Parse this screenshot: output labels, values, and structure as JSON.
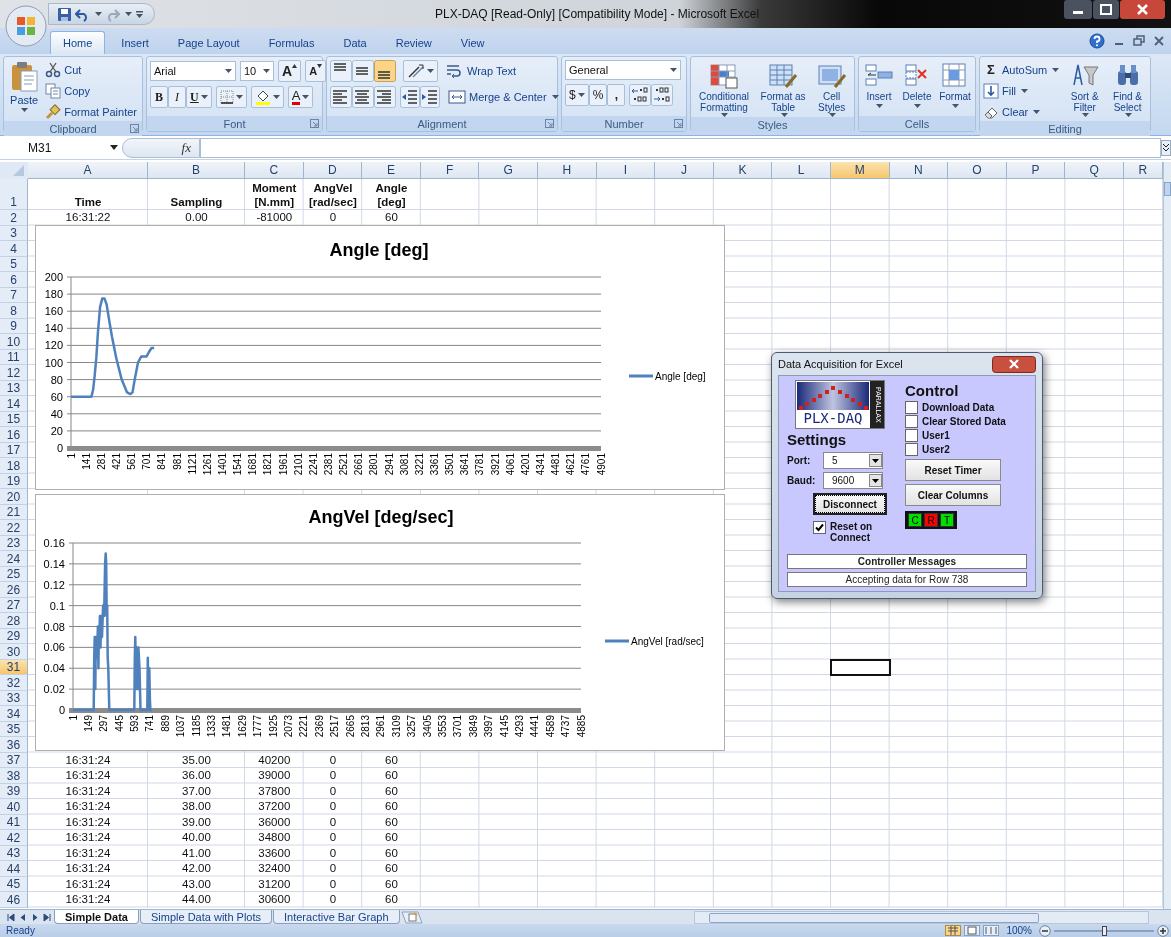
{
  "title_bar": {
    "title": "PLX-DAQ  [Read-Only]  [Compatibility Mode] - Microsoft Excel"
  },
  "ribbon_tabs": [
    {
      "label": "Home",
      "selected": true
    },
    {
      "label": "Insert",
      "selected": false
    },
    {
      "label": "Page Layout",
      "selected": false
    },
    {
      "label": "Formulas",
      "selected": false
    },
    {
      "label": "Data",
      "selected": false
    },
    {
      "label": "Review",
      "selected": false
    },
    {
      "label": "View",
      "selected": false
    }
  ],
  "ribbon": {
    "clipboard": {
      "label": "Clipboard",
      "paste": "Paste",
      "cut": "Cut",
      "copy": "Copy",
      "format_painter": "Format Painter"
    },
    "font": {
      "label": "Font",
      "font_name": "Arial",
      "font_size": "10",
      "grow": "A",
      "shrink": "A",
      "styles": [
        {
          "label": "B",
          "kind": "bold"
        },
        {
          "label": "I",
          "kind": "italic"
        },
        {
          "label": "U",
          "kind": "underline"
        }
      ],
      "font_color": "A"
    },
    "alignment": {
      "label": "Alignment",
      "vertical": [
        {
          "kind": "top",
          "selected": false
        },
        {
          "kind": "middle",
          "selected": false
        },
        {
          "kind": "bottom",
          "selected": true
        }
      ],
      "horizontal": [
        {
          "kind": "left",
          "selected": false
        },
        {
          "kind": "center",
          "selected": false
        },
        {
          "kind": "right",
          "selected": false
        }
      ],
      "wrap_text": "Wrap Text",
      "merge_center": "Merge & Center"
    },
    "number": {
      "label": "Number",
      "format": "General",
      "currency": "$",
      "percent": "%",
      "comma": ","
    },
    "styles": {
      "label": "Styles",
      "buttons": [
        {
          "label": "Conditional Formatting",
          "kind": "conditional"
        },
        {
          "label": "Format as Table",
          "kind": "table"
        },
        {
          "label": "Cell Styles",
          "kind": "cell_styles"
        }
      ]
    },
    "cells": {
      "label": "Cells",
      "buttons": [
        {
          "label": "Insert",
          "kind": "insert"
        },
        {
          "label": "Delete",
          "kind": "delete"
        },
        {
          "label": "Format",
          "kind": "format"
        }
      ]
    },
    "editing": {
      "label": "Editing",
      "autosum_symbol": "Σ",
      "autosum": "AutoSum",
      "fill": "Fill",
      "clear": "Clear",
      "sort_filter": "Sort & Filter",
      "find_select": "Find & Select"
    }
  },
  "formula_bar": {
    "name_box": "M31",
    "fx": "fx"
  },
  "sheet": {
    "columns": [
      {
        "label": "A",
        "selected": false
      },
      {
        "label": "B",
        "selected": false
      },
      {
        "label": "C",
        "selected": false
      },
      {
        "label": "D",
        "selected": false
      },
      {
        "label": "E",
        "selected": false
      },
      {
        "label": "F",
        "selected": false
      },
      {
        "label": "G",
        "selected": false
      },
      {
        "label": "H",
        "selected": false
      },
      {
        "label": "I",
        "selected": false
      },
      {
        "label": "J",
        "selected": false
      },
      {
        "label": "K",
        "selected": false
      },
      {
        "label": "L",
        "selected": false
      },
      {
        "label": "M",
        "selected": true
      },
      {
        "label": "N",
        "selected": false
      },
      {
        "label": "O",
        "selected": false
      },
      {
        "label": "P",
        "selected": false
      },
      {
        "label": "Q",
        "selected": false
      },
      {
        "label": "R",
        "selected": false
      }
    ],
    "rows": [
      {
        "number": "1",
        "selected": false,
        "kind": "header",
        "cells": [
          "Time",
          "Sampling",
          "Moment [N.mm]",
          "AngVel [rad/sec]",
          "Angle [deg]"
        ]
      },
      {
        "number": "2",
        "selected": false,
        "kind": "data",
        "cells": [
          "16:31:22",
          "0.00",
          "-81000",
          "0",
          "60"
        ]
      },
      {
        "number": "3",
        "selected": false,
        "kind": "data"
      },
      {
        "number": "4",
        "selected": false,
        "kind": "data"
      },
      {
        "number": "5",
        "selected": false,
        "kind": "data"
      },
      {
        "number": "6",
        "selected": false,
        "kind": "data"
      },
      {
        "number": "7",
        "selected": false,
        "kind": "data"
      },
      {
        "number": "8",
        "selected": false,
        "kind": "data"
      },
      {
        "number": "9",
        "selected": false,
        "kind": "data"
      },
      {
        "number": "10",
        "selected": false,
        "kind": "data"
      },
      {
        "number": "11",
        "selected": false,
        "kind": "data"
      },
      {
        "number": "12",
        "selected": false,
        "kind": "data"
      },
      {
        "number": "13",
        "selected": false,
        "kind": "data"
      },
      {
        "number": "14",
        "selected": false,
        "kind": "data"
      },
      {
        "number": "15",
        "selected": false,
        "kind": "data"
      },
      {
        "number": "16",
        "selected": false,
        "kind": "data"
      },
      {
        "number": "17",
        "selected": false,
        "kind": "data"
      },
      {
        "number": "18",
        "selected": false,
        "kind": "data"
      },
      {
        "number": "19",
        "selected": false,
        "kind": "data"
      },
      {
        "number": "20",
        "selected": false,
        "kind": "data"
      },
      {
        "number": "21",
        "selected": false,
        "kind": "data"
      },
      {
        "number": "22",
        "selected": false,
        "kind": "data"
      },
      {
        "number": "23",
        "selected": false,
        "kind": "data"
      },
      {
        "number": "24",
        "selected": false,
        "kind": "data"
      },
      {
        "number": "25",
        "selected": false,
        "kind": "data"
      },
      {
        "number": "26",
        "selected": false,
        "kind": "data"
      },
      {
        "number": "27",
        "selected": false,
        "kind": "data"
      },
      {
        "number": "28",
        "selected": false,
        "kind": "data"
      },
      {
        "number": "29",
        "selected": false,
        "kind": "data"
      },
      {
        "number": "30",
        "selected": false,
        "kind": "data"
      },
      {
        "number": "31",
        "selected": true,
        "kind": "data"
      },
      {
        "number": "32",
        "selected": false,
        "kind": "data"
      },
      {
        "number": "33",
        "selected": false,
        "kind": "data"
      },
      {
        "number": "34",
        "selected": false,
        "kind": "data"
      },
      {
        "number": "35",
        "selected": false,
        "kind": "data"
      },
      {
        "number": "36",
        "selected": false,
        "kind": "data"
      },
      {
        "number": "37",
        "selected": false,
        "kind": "data",
        "cells": [
          "16:31:24",
          "35.00",
          "40200",
          "0",
          "60"
        ]
      },
      {
        "number": "38",
        "selected": false,
        "kind": "data",
        "cells": [
          "16:31:24",
          "36.00",
          "39000",
          "0",
          "60"
        ]
      },
      {
        "number": "39",
        "selected": false,
        "kind": "data",
        "cells": [
          "16:31:24",
          "37.00",
          "37800",
          "0",
          "60"
        ]
      },
      {
        "number": "40",
        "selected": false,
        "kind": "data",
        "cells": [
          "16:31:24",
          "38.00",
          "37200",
          "0",
          "60"
        ]
      },
      {
        "number": "41",
        "selected": false,
        "kind": "data",
        "cells": [
          "16:31:24",
          "39.00",
          "36000",
          "0",
          "60"
        ]
      },
      {
        "number": "42",
        "selected": false,
        "kind": "data",
        "cells": [
          "16:31:24",
          "40.00",
          "34800",
          "0",
          "60"
        ]
      },
      {
        "number": "43",
        "selected": false,
        "kind": "data",
        "cells": [
          "16:31:24",
          "41.00",
          "33600",
          "0",
          "60"
        ]
      },
      {
        "number": "44",
        "selected": false,
        "kind": "data",
        "cells": [
          "16:31:24",
          "42.00",
          "32400",
          "0",
          "60"
        ]
      },
      {
        "number": "45",
        "selected": false,
        "kind": "data",
        "cells": [
          "16:31:24",
          "43.00",
          "31200",
          "0",
          "60"
        ]
      },
      {
        "number": "46",
        "selected": false,
        "kind": "data",
        "cells": [
          "16:31:24",
          "44.00",
          "30600",
          "0",
          "60"
        ]
      }
    ],
    "charts": [
      {
        "chart_data": {
          "type": "line",
          "title": "Angle [deg]",
          "x": [
            1,
            190,
            205,
            220,
            235,
            250,
            270,
            290,
            310,
            330,
            360,
            380,
            420,
            470,
            520,
            550,
            570,
            590,
            620,
            650,
            670,
            700,
            720,
            745,
            770
          ],
          "series": [
            {
              "name": "Angle [deg]",
              "color": "#4f81bd",
              "values": [
                60,
                60,
                68,
                85,
                105,
                135,
                165,
                175,
                175,
                168,
                145,
                130,
                105,
                80,
                65,
                63,
                65,
                80,
                100,
                107,
                107,
                107,
                112,
                117,
                117
              ]
            }
          ],
          "xlim": [
            1,
            4901
          ],
          "ylim": [
            0,
            200
          ],
          "grid": true,
          "yticks": [
            0,
            20,
            40,
            60,
            80,
            100,
            120,
            140,
            160,
            180,
            200
          ],
          "xticks": [
            1,
            141,
            281,
            421,
            561,
            701,
            841,
            981,
            1121,
            1261,
            1401,
            1541,
            1681,
            1821,
            1961,
            2101,
            2241,
            2381,
            2521,
            2661,
            2801,
            2941,
            3081,
            3221,
            3361,
            3501,
            3641,
            3781,
            3921,
            4061,
            4201,
            4341,
            4481,
            4621,
            4761,
            4901
          ]
        }
      },
      {
        "chart_data": {
          "type": "line",
          "title": "AngVel [deg/sec]",
          "x": [
            1,
            200,
            205,
            210,
            215,
            220,
            225,
            230,
            235,
            240,
            245,
            250,
            255,
            260,
            265,
            270,
            280,
            290,
            300,
            310,
            315,
            320,
            325,
            330,
            335,
            340,
            345,
            350,
            360,
            590,
            595,
            600,
            605,
            610,
            615,
            620,
            625,
            630,
            640,
            650,
            660,
            665,
            680,
            715,
            720,
            725,
            730,
            735,
            740,
            745,
            760
          ],
          "series": [
            {
              "name": "AngVel [rad/sec]",
              "color": "#4f81bd",
              "values": [
                0,
                0,
                0.05,
                0.07,
                0.02,
                0.07,
                0.05,
                0.07,
                0.06,
                0.08,
                0.04,
                0.08,
                0.07,
                0.09,
                0.06,
                0.09,
                0.07,
                0.1,
                0.09,
                0.14,
                0.15,
                0.14,
                0.09,
                0.1,
                0.05,
                0.04,
                0.02,
                0,
                0,
                0,
                0.05,
                0.07,
                0.04,
                0.02,
                0.06,
                0.05,
                0.02,
                0.06,
                0.04,
                0,
                0,
                0,
                0,
                0,
                0.05,
                0.02,
                0,
                0.04,
                0.01,
                0,
                0
              ]
            }
          ],
          "xlim": [
            1,
            4885
          ],
          "ylim": [
            0,
            0.16
          ],
          "grid": true,
          "yticks": [
            0,
            0.02,
            0.04,
            0.06,
            0.08,
            0.1,
            0.12,
            0.14,
            0.16
          ],
          "xticks": [
            1,
            149,
            297,
            445,
            593,
            741,
            889,
            1037,
            1185,
            1333,
            1481,
            1629,
            1777,
            1925,
            2073,
            2221,
            2369,
            2517,
            2665,
            2813,
            2961,
            3109,
            3257,
            3405,
            3553,
            3701,
            3849,
            3997,
            4145,
            4293,
            4441,
            4589,
            4737,
            4885
          ]
        }
      }
    ]
  },
  "daq_dialog": {
    "title": "Data Acquisition for Excel",
    "logo_text": "PLX-DAQ",
    "logo_brand": "PARALLAX",
    "settings_heading": "Settings",
    "port_label": "Port:",
    "port": "5",
    "baud_label": "Baud:",
    "baud": "9600",
    "connect_button": "Disconnect",
    "reset_on_connect": {
      "label": "Reset on Connect",
      "checked": true
    },
    "control_heading": "Control",
    "control_options": [
      {
        "label": "Download Data",
        "checked": false
      },
      {
        "label": "Clear Stored Data",
        "checked": false
      },
      {
        "label": "User1",
        "checked": false
      },
      {
        "label": "User2",
        "checked": false
      }
    ],
    "buttons": [
      "Reset Timer",
      "Clear Columns"
    ],
    "indicators": [
      {
        "label": "C",
        "color": "#00e000"
      },
      {
        "label": "R",
        "color": "#ff0000"
      },
      {
        "label": "T",
        "color": "#00e000"
      }
    ],
    "messages_heading": "Controller Messages",
    "message": "Accepting data for Row 738"
  },
  "sheet_tabs": [
    {
      "label": "Simple Data",
      "selected": true
    },
    {
      "label": "Simple Data with Plots",
      "selected": false
    },
    {
      "label": "Interactive Bar Graph",
      "selected": false
    }
  ],
  "status_bar": {
    "status": "Ready",
    "zoom": "100%",
    "zoom_slider": {
      "level": 0.5
    }
  }
}
